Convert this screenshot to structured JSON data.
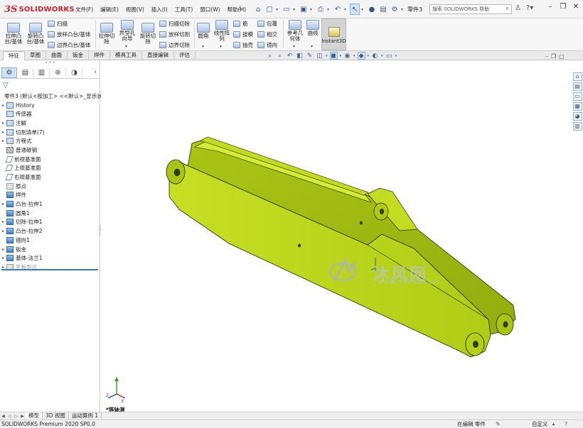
{
  "app": {
    "logo_text": "SOLIDWORKS",
    "menus": [
      "文件(F)",
      "编辑(E)",
      "视图(V)",
      "插入(I)",
      "工具(T)",
      "窗口(W)",
      "帮助(H)"
    ],
    "document_name": "零件3",
    "search_placeholder": "搜索 SOLIDWORKS 帮助"
  },
  "command_manager": {
    "extrude_boss": "拉伸凸\n台/基体",
    "revolve_boss": "旋转凸\n台/基体",
    "sweep": "扫描",
    "loft": "放样凸台/基体",
    "boundary_boss": "边界凸台/基体",
    "extrude_cut": "拉伸切\n除",
    "hole_wizard": "异型孔\n向导",
    "revolve_cut": "旋转切\n除",
    "swept_cut": "扫描切除",
    "lofted_cut": "放样切割",
    "boundary_cut": "边界切除",
    "fillet": "圆角",
    "linear_pattern": "线性阵\n列",
    "rib": "筋",
    "draft": "拔模",
    "shell": "抽壳",
    "wrap": "包覆",
    "intersect": "相交",
    "mirror": "镜向",
    "ref_geometry": "参考几\n何体",
    "curves": "曲线",
    "instant3d": "Instant3D"
  },
  "tabs": [
    "特征",
    "草图",
    "曲面",
    "钣金",
    "焊件",
    "模具工具",
    "直接编辑",
    "评估"
  ],
  "feature_tree": {
    "root": "零件3  (默认<按加工> <<默认>_显示状",
    "items": [
      {
        "label": "History",
        "icon": "history-folder-icon",
        "expandable": true
      },
      {
        "label": "传感器",
        "icon": "sensor-icon",
        "expandable": false
      },
      {
        "label": "注解",
        "icon": "annotation-icon",
        "expandable": true
      },
      {
        "label": "切割清单(7)",
        "icon": "cutlist-icon",
        "expandable": true
      },
      {
        "label": "方程式",
        "icon": "equation-icon",
        "expandable": true
      },
      {
        "label": "普通碳钢",
        "icon": "material-icon",
        "expandable": false
      },
      {
        "label": "前视基准面",
        "icon": "plane-icon",
        "expandable": false
      },
      {
        "label": "上视基准面",
        "icon": "plane-icon",
        "expandable": false
      },
      {
        "label": "右视基准面",
        "icon": "plane-icon",
        "expandable": false
      },
      {
        "label": "原点",
        "icon": "origin-icon",
        "expandable": false
      },
      {
        "label": "焊件",
        "icon": "weldment-icon",
        "expandable": false
      },
      {
        "label": "凸台-拉伸1",
        "icon": "boss-extrude-icon",
        "expandable": true
      },
      {
        "label": "圆角1",
        "icon": "fillet-icon",
        "expandable": false
      },
      {
        "label": "切除-拉伸1",
        "icon": "cut-extrude-icon",
        "expandable": true
      },
      {
        "label": "凸台-拉伸2",
        "icon": "boss-extrude-icon",
        "expandable": true
      },
      {
        "label": "镜向1",
        "icon": "mirror-icon",
        "expandable": false
      },
      {
        "label": "钣金",
        "icon": "sheetmetal-icon",
        "expandable": true
      },
      {
        "label": "基体-法兰1",
        "icon": "base-flange-icon",
        "expandable": true
      },
      {
        "label": "平板型式",
        "icon": "flat-pattern-icon",
        "expandable": true,
        "dim": true
      }
    ]
  },
  "viewport": {
    "view_label": "*等轴测",
    "watermark_text": "沐风网",
    "watermark_url": "www.mfcad.com",
    "part_color": "#b6d31a"
  },
  "bottom_tabs": [
    "模型",
    "3D 视图",
    "运动算例 1"
  ],
  "status": {
    "product": "SOLIDWORKS Premium 2020 SP0.0",
    "mode": "在编辑 零件",
    "units": "自定义"
  }
}
